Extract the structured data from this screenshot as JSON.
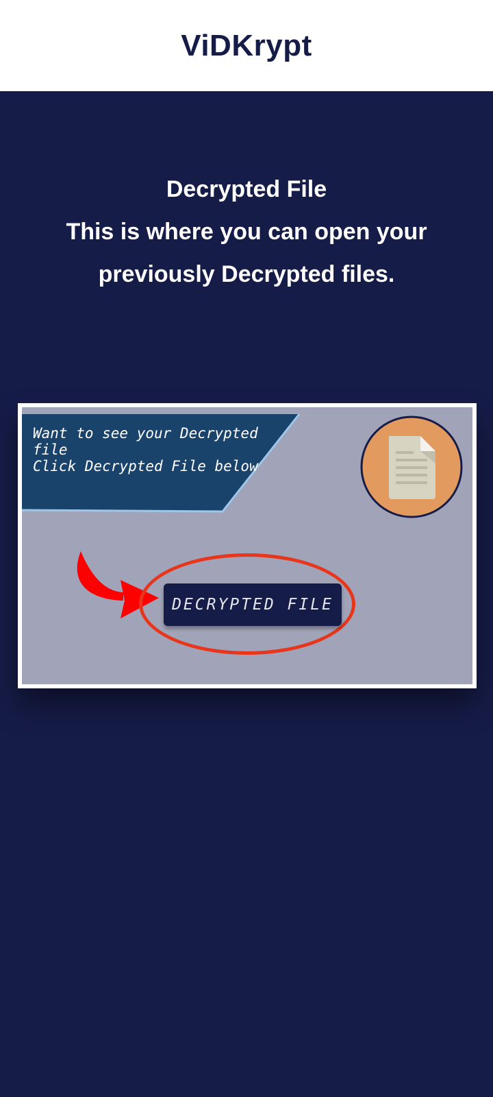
{
  "header": {
    "title": "ViDKrypt"
  },
  "intro": {
    "heading": "Decrypted File",
    "line1": "This is where you can open your",
    "line2": "previously Decrypted files."
  },
  "tutorial": {
    "banner_line1": "Want to see your Decrypted",
    "banner_line2": "file",
    "banner_line3": "Click Decrypted File below",
    "button_label": "DECRYPTED FILE",
    "icons": [
      "file-document-icon",
      "curved-arrow-icon"
    ]
  },
  "colors": {
    "background": "#161c48",
    "header_bg": "#ffffff",
    "banner_bg": "#1a436b",
    "ring": "#e8361c",
    "arrow": "#ff0000",
    "badge": "#e29a5f"
  }
}
